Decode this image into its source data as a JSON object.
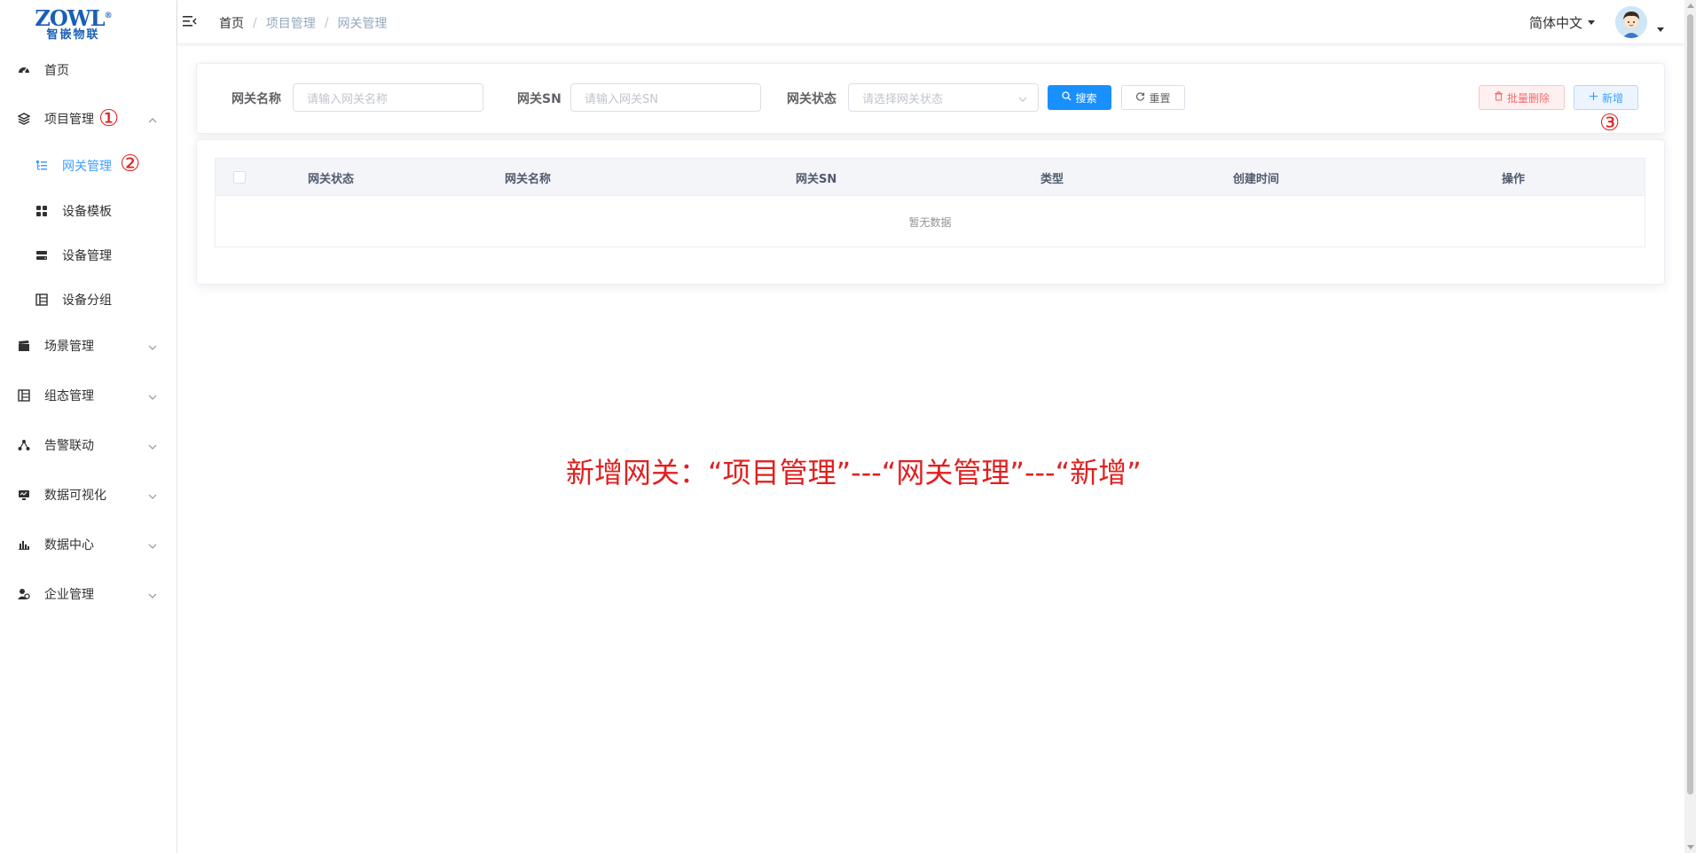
{
  "logo": {
    "brand": "ZOWL",
    "sub": "智嵌物联"
  },
  "sidebar": {
    "items": [
      {
        "label": "首页",
        "icon": "dashboard-icon"
      },
      {
        "label": "项目管理",
        "icon": "layers-icon",
        "expanded": true
      },
      {
        "label": "场景管理",
        "icon": "clapper-icon"
      },
      {
        "label": "组态管理",
        "icon": "tree-table-icon"
      },
      {
        "label": "告警联动",
        "icon": "network-icon"
      },
      {
        "label": "数据可视化",
        "icon": "monitor-icon"
      },
      {
        "label": "数据中心",
        "icon": "bar-chart-icon"
      },
      {
        "label": "企业管理",
        "icon": "people-icon"
      }
    ],
    "sub_items": [
      {
        "label": "网关管理",
        "icon": "tree-list-icon",
        "active": true
      },
      {
        "label": "设备模板",
        "icon": "grid-icon"
      },
      {
        "label": "设备管理",
        "icon": "server-icon"
      },
      {
        "label": "设备分组",
        "icon": "group-icon"
      }
    ]
  },
  "header": {
    "breadcrumb": [
      "首页",
      "项目管理",
      "网关管理"
    ],
    "language": "简体中文"
  },
  "search": {
    "name_label": "网关名称",
    "name_placeholder": "请输入网关名称",
    "sn_label": "网关SN",
    "sn_placeholder": "请输入网关SN",
    "status_label": "网关状态",
    "status_placeholder": "请选择网关状态",
    "search_btn": "搜索",
    "reset_btn": "重置",
    "batch_delete_btn": "批量删除",
    "add_btn": "新增"
  },
  "table": {
    "columns": [
      "网关状态",
      "网关名称",
      "网关SN",
      "类型",
      "创建时间",
      "操作"
    ],
    "empty_text": "暂无数据"
  },
  "annotations": {
    "step1": "①",
    "step2": "②",
    "step3": "③",
    "instruction": "新增网关：“项目管理”---“网关管理”---“新增”"
  },
  "colors": {
    "accent": "#1890ff",
    "annotation": "#e02020",
    "danger": "#f56c6c"
  }
}
